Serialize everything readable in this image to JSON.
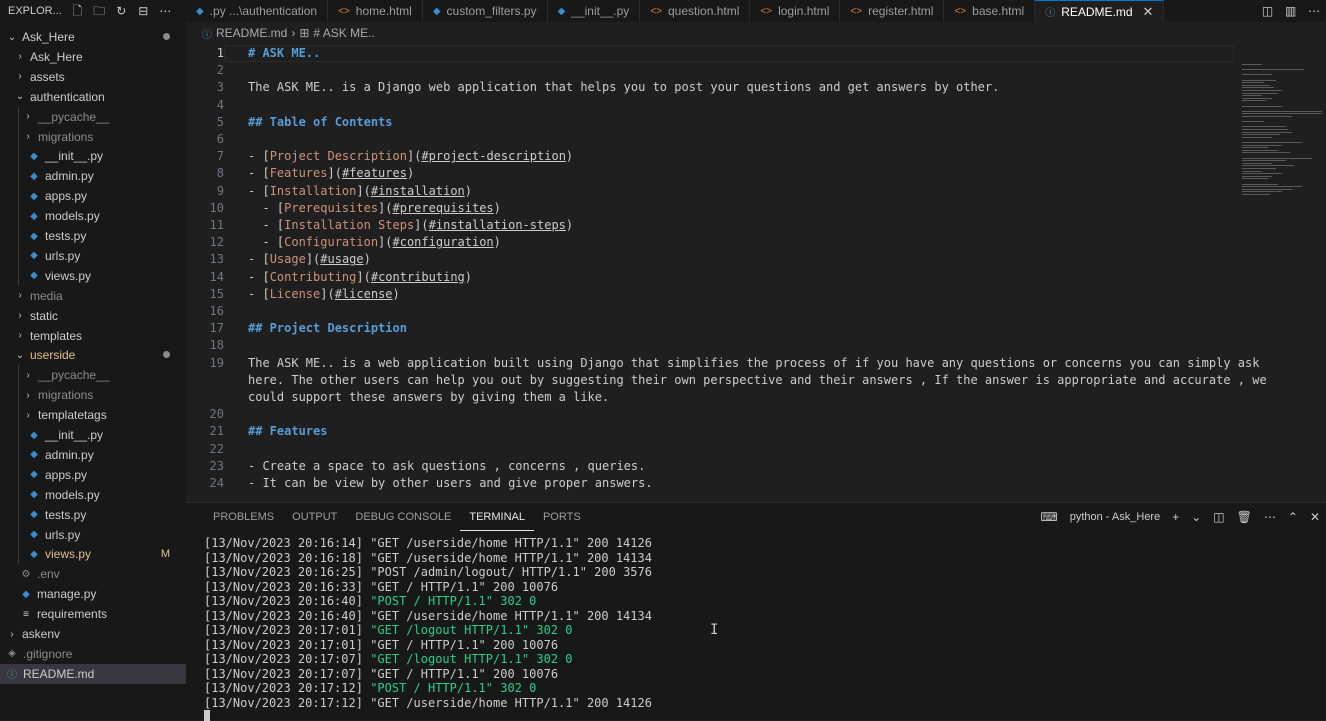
{
  "explorer": {
    "title": "EXPLOR..."
  },
  "tabs": [
    {
      "label": ".py ...\\authentication",
      "kind": "py"
    },
    {
      "label": "home.html",
      "kind": "html"
    },
    {
      "label": "custom_filters.py",
      "kind": "py"
    },
    {
      "label": "__init__.py",
      "kind": "py"
    },
    {
      "label": "question.html",
      "kind": "html"
    },
    {
      "label": "login.html",
      "kind": "html"
    },
    {
      "label": "register.html",
      "kind": "html"
    },
    {
      "label": "base.html",
      "kind": "html"
    },
    {
      "label": "README.md",
      "kind": "md",
      "active": true
    }
  ],
  "tree": [
    {
      "label": "Ask_Here",
      "level": 0,
      "chevron": "down",
      "dot": true
    },
    {
      "label": "Ask_Here",
      "level": 1,
      "chevron": "right"
    },
    {
      "label": "assets",
      "level": 1,
      "chevron": "right"
    },
    {
      "label": "authentication",
      "level": 1,
      "chevron": "down"
    },
    {
      "label": "__pycache__",
      "level": 2,
      "chevron": "right",
      "dim": true
    },
    {
      "label": "migrations",
      "level": 2,
      "chevron": "right",
      "dim": true
    },
    {
      "label": "__init__.py",
      "level": 2,
      "file": "py"
    },
    {
      "label": "admin.py",
      "level": 2,
      "file": "py"
    },
    {
      "label": "apps.py",
      "level": 2,
      "file": "py"
    },
    {
      "label": "models.py",
      "level": 2,
      "file": "py"
    },
    {
      "label": "tests.py",
      "level": 2,
      "file": "py"
    },
    {
      "label": "urls.py",
      "level": 2,
      "file": "py"
    },
    {
      "label": "views.py",
      "level": 2,
      "file": "py"
    },
    {
      "label": "media",
      "level": 1,
      "chevron": "right",
      "dim": true
    },
    {
      "label": "static",
      "level": 1,
      "chevron": "right"
    },
    {
      "label": "templates",
      "level": 1,
      "chevron": "right"
    },
    {
      "label": "userside",
      "level": 1,
      "chevron": "down",
      "dot": true,
      "modified": true
    },
    {
      "label": "__pycache__",
      "level": 2,
      "chevron": "right",
      "dim": true
    },
    {
      "label": "migrations",
      "level": 2,
      "chevron": "right",
      "dim": true
    },
    {
      "label": "templatetags",
      "level": 2,
      "chevron": "right"
    },
    {
      "label": "__init__.py",
      "level": 2,
      "file": "py"
    },
    {
      "label": "admin.py",
      "level": 2,
      "file": "py"
    },
    {
      "label": "apps.py",
      "level": 2,
      "file": "py"
    },
    {
      "label": "models.py",
      "level": 2,
      "file": "py"
    },
    {
      "label": "tests.py",
      "level": 2,
      "file": "py"
    },
    {
      "label": "urls.py",
      "level": 2,
      "file": "py"
    },
    {
      "label": "views.py",
      "level": 2,
      "file": "py",
      "modified": true,
      "badge": "M"
    },
    {
      "label": ".env",
      "level": 1,
      "file": "gear",
      "dim": true
    },
    {
      "label": "manage.py",
      "level": 1,
      "file": "py"
    },
    {
      "label": "requirements",
      "level": 1,
      "file": "list"
    },
    {
      "label": "askenv",
      "level": 0,
      "chevron": "right"
    },
    {
      "label": ".gitignore",
      "level": 0,
      "file": "git",
      "dim": true
    },
    {
      "label": "README.md",
      "level": 0,
      "file": "info",
      "active": true
    }
  ],
  "breadcrumb": {
    "file": "README.md",
    "section": "# ASK ME.."
  },
  "code_lines": [
    {
      "n": "1",
      "segs": [
        [
          "hd",
          "# ASK ME.."
        ]
      ]
    },
    {
      "n": "2",
      "segs": []
    },
    {
      "n": "3",
      "segs": [
        [
          "t",
          "The ASK ME.. is a Django web application that helps you to post your questions and get answers by other."
        ]
      ]
    },
    {
      "n": "4",
      "segs": []
    },
    {
      "n": "5",
      "segs": [
        [
          "hd",
          "## Table of Contents"
        ]
      ]
    },
    {
      "n": "6",
      "segs": []
    },
    {
      "n": "7",
      "segs": [
        [
          "t",
          "- ["
        ],
        [
          "lk",
          "Project Description"
        ],
        [
          "t",
          "]("
        ],
        [
          "lu",
          "#project-description"
        ],
        [
          "t",
          ")"
        ]
      ]
    },
    {
      "n": "8",
      "segs": [
        [
          "t",
          "- ["
        ],
        [
          "lk",
          "Features"
        ],
        [
          "t",
          "]("
        ],
        [
          "lu",
          "#features"
        ],
        [
          "t",
          ")"
        ]
      ]
    },
    {
      "n": "9",
      "segs": [
        [
          "t",
          "- ["
        ],
        [
          "lk",
          "Installation"
        ],
        [
          "t",
          "]("
        ],
        [
          "lu",
          "#installation"
        ],
        [
          "t",
          ")"
        ]
      ]
    },
    {
      "n": "10",
      "segs": [
        [
          "t",
          "  - ["
        ],
        [
          "lk",
          "Prerequisites"
        ],
        [
          "t",
          "]("
        ],
        [
          "lu",
          "#prerequisites"
        ],
        [
          "t",
          ")"
        ]
      ]
    },
    {
      "n": "11",
      "segs": [
        [
          "t",
          "  - ["
        ],
        [
          "lk",
          "Installation Steps"
        ],
        [
          "t",
          "]("
        ],
        [
          "lu",
          "#installation-steps"
        ],
        [
          "t",
          ")"
        ]
      ]
    },
    {
      "n": "12",
      "segs": [
        [
          "t",
          "  - ["
        ],
        [
          "lk",
          "Configuration"
        ],
        [
          "t",
          "]("
        ],
        [
          "lu",
          "#configuration"
        ],
        [
          "t",
          ")"
        ]
      ]
    },
    {
      "n": "13",
      "segs": [
        [
          "t",
          "- ["
        ],
        [
          "lk",
          "Usage"
        ],
        [
          "t",
          "]("
        ],
        [
          "lu",
          "#usage"
        ],
        [
          "t",
          ")"
        ]
      ]
    },
    {
      "n": "14",
      "segs": [
        [
          "t",
          "- ["
        ],
        [
          "lk",
          "Contributing"
        ],
        [
          "t",
          "]("
        ],
        [
          "lu",
          "#contributing"
        ],
        [
          "t",
          ")"
        ]
      ]
    },
    {
      "n": "15",
      "segs": [
        [
          "t",
          "- ["
        ],
        [
          "lk",
          "License"
        ],
        [
          "t",
          "]("
        ],
        [
          "lu",
          "#license"
        ],
        [
          "t",
          ")"
        ]
      ]
    },
    {
      "n": "16",
      "segs": []
    },
    {
      "n": "17",
      "segs": [
        [
          "hd",
          "## Project Description"
        ]
      ]
    },
    {
      "n": "18",
      "segs": []
    },
    {
      "n": "19",
      "segs": [
        [
          "t",
          "The ASK ME.. is a web application built using Django that simplifies the process of if you have any questions or concerns you can simply ask"
        ]
      ]
    },
    {
      "n": "",
      "segs": [
        [
          "t",
          "here. The other users can help you out by suggesting their own perspective and their answers , If the answer is appropriate and accurate , we"
        ]
      ]
    },
    {
      "n": "",
      "segs": [
        [
          "t",
          "could support these answers by giving them a like."
        ]
      ]
    },
    {
      "n": "20",
      "segs": []
    },
    {
      "n": "21",
      "segs": [
        [
          "hd",
          "## Features"
        ]
      ]
    },
    {
      "n": "22",
      "segs": []
    },
    {
      "n": "23",
      "segs": [
        [
          "t",
          "- Create a space to ask questions , concerns , queries."
        ]
      ]
    },
    {
      "n": "24",
      "segs": [
        [
          "t",
          "- It can be view by other users and give proper answers."
        ]
      ]
    }
  ],
  "panel": {
    "tabs": [
      "PROBLEMS",
      "OUTPUT",
      "DEBUG CONSOLE",
      "TERMINAL",
      "PORTS"
    ],
    "active_tab": "TERMINAL",
    "terminal_name": "python - Ask_Here"
  },
  "terminal_lines": [
    {
      "ts": "[13/Nov/2023 20:16:14]",
      "req": "\"GET /userside/home HTTP/1.1\"",
      "status": "200 14126",
      "green": false
    },
    {
      "ts": "[13/Nov/2023 20:16:18]",
      "req": "\"GET /userside/home HTTP/1.1\"",
      "status": "200 14134",
      "green": false
    },
    {
      "ts": "[13/Nov/2023 20:16:25]",
      "req": "\"POST /admin/logout/ HTTP/1.1\"",
      "status": "200 3576",
      "green": false
    },
    {
      "ts": "[13/Nov/2023 20:16:33]",
      "req": "\"GET / HTTP/1.1\"",
      "status": "200 10076",
      "green": false
    },
    {
      "ts": "[13/Nov/2023 20:16:40]",
      "req": "\"POST / HTTP/1.1\"",
      "status": "302 0",
      "green": true
    },
    {
      "ts": "[13/Nov/2023 20:16:40]",
      "req": "\"GET /userside/home HTTP/1.1\"",
      "status": "200 14134",
      "green": false
    },
    {
      "ts": "[13/Nov/2023 20:17:01]",
      "req": "\"GET /logout HTTP/1.1\"",
      "status": "302 0",
      "green": true
    },
    {
      "ts": "[13/Nov/2023 20:17:01]",
      "req": "\"GET / HTTP/1.1\"",
      "status": "200 10076",
      "green": false
    },
    {
      "ts": "[13/Nov/2023 20:17:07]",
      "req": "\"GET /logout HTTP/1.1\"",
      "status": "302 0",
      "green": true
    },
    {
      "ts": "[13/Nov/2023 20:17:07]",
      "req": "\"GET / HTTP/1.1\"",
      "status": "200 10076",
      "green": false
    },
    {
      "ts": "[13/Nov/2023 20:17:12]",
      "req": "\"POST / HTTP/1.1\"",
      "status": "302 0",
      "green": true
    },
    {
      "ts": "[13/Nov/2023 20:17:12]",
      "req": "\"GET /userside/home HTTP/1.1\"",
      "status": "200 14126",
      "green": false
    }
  ],
  "icons": {
    "new_file": "new-file-icon",
    "new_folder": "new-folder-icon",
    "refresh": "refresh-icon",
    "collapse": "collapse-all-icon",
    "more": "ellipsis-icon",
    "close": "close-icon"
  },
  "colors": {
    "accent": "#0078d4",
    "terminal_green": "#23d18b",
    "heading": "#569cd6",
    "link_text": "#ce9178",
    "modified": "#e2c08d"
  }
}
